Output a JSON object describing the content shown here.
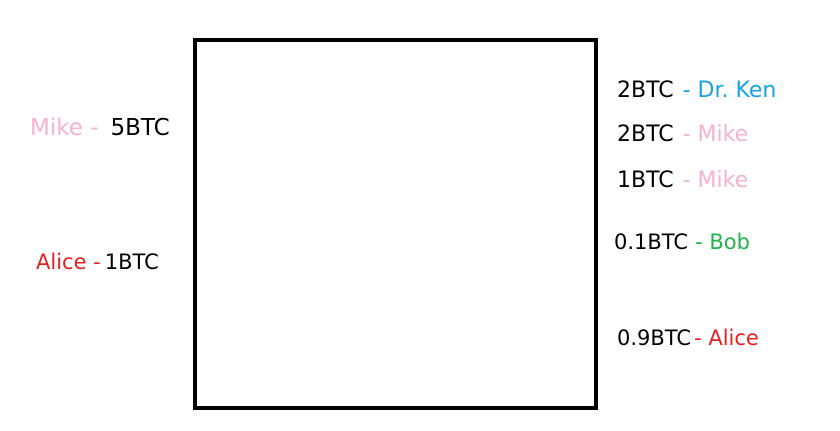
{
  "colors": {
    "mike": "#f4b4cf",
    "alice": "#e52222",
    "dr_ken": "#1aa3e3",
    "bob": "#22b34a",
    "amount": "#000000"
  },
  "inputs": [
    {
      "owner": "Mike -",
      "amount": "5BTC",
      "owner_color": "#f4b4cf"
    },
    {
      "owner": "Alice -",
      "amount": "1BTC",
      "owner_color": "#e52222"
    }
  ],
  "outputs": [
    {
      "amount": "2BTC",
      "owner": "- Dr. Ken",
      "owner_color": "#1aa3e3"
    },
    {
      "amount": "2BTC",
      "owner": "- Mike",
      "owner_color": "#f4b4cf"
    },
    {
      "amount": "1BTC",
      "owner": "- Mike",
      "owner_color": "#f4b4cf"
    },
    {
      "amount": "0.1BTC",
      "owner": "- Bob",
      "owner_color": "#22b34a"
    },
    {
      "amount": "0.9BTC",
      "owner": "- Alice",
      "owner_color": "#e52222"
    }
  ]
}
